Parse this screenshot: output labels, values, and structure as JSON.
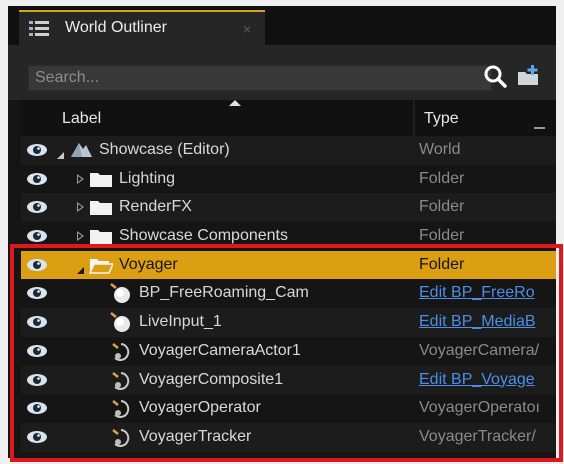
{
  "tab": {
    "title": "World Outliner",
    "close": "×"
  },
  "search": {
    "placeholder": "Search..."
  },
  "columns": {
    "label": "Label",
    "type": "Type"
  },
  "colors": {
    "accent": "#dc9e12",
    "highlight": "#e0171f",
    "link": "#4d8ee8"
  },
  "rows": [
    {
      "label": "Showcase (Editor)",
      "type": "World",
      "icon": "world-icon",
      "expander": "down",
      "link": false
    },
    {
      "label": "Lighting",
      "type": "Folder",
      "icon": "folder-icon",
      "expander": "right",
      "link": false
    },
    {
      "label": "RenderFX",
      "type": "Folder",
      "icon": "folder-icon",
      "expander": "right",
      "link": false
    },
    {
      "label": "Showcase Components",
      "type": "Folder",
      "icon": "folder-icon",
      "expander": "right",
      "link": false
    },
    {
      "label": "Voyager",
      "type": "Folder",
      "icon": "folder-open-icon",
      "expander": "down",
      "link": false,
      "selected": true
    },
    {
      "label": "BP_FreeRoaming_Cam",
      "type": "Edit BP_FreeRo",
      "icon": "sphere-icon",
      "link": true
    },
    {
      "label": "LiveInput_1",
      "type": "Edit BP_MediaB",
      "icon": "sphere-icon",
      "link": true
    },
    {
      "label": "VoyagerCameraActor1",
      "type": "VoyagerCamera/",
      "icon": "actor-icon",
      "link": false
    },
    {
      "label": "VoyagerComposite1",
      "type": "Edit BP_Voyage",
      "icon": "actor-icon",
      "link": true
    },
    {
      "label": "VoyagerOperator",
      "type": "VoyagerOperatoı",
      "icon": "actor-icon",
      "link": false
    },
    {
      "label": "VoyagerTracker",
      "type": "VoyagerTracker/",
      "icon": "actor-icon",
      "link": false
    }
  ]
}
